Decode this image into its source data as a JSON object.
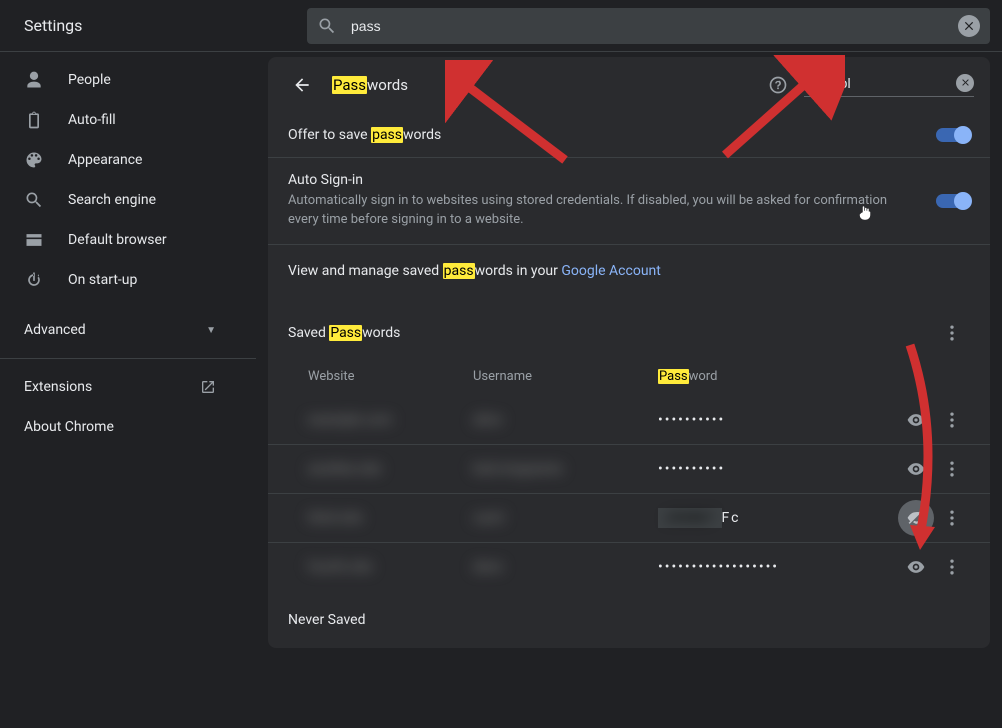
{
  "header": {
    "title": "Settings",
    "search_value": "pass"
  },
  "sidebar": {
    "items": [
      {
        "label": "People"
      },
      {
        "label": "Auto-fill"
      },
      {
        "label": "Appearance"
      },
      {
        "label": "Search engine"
      },
      {
        "label": "Default browser"
      },
      {
        "label": "On start-up"
      }
    ],
    "advanced": "Advanced",
    "extensions": "Extensions",
    "about": "About Chrome"
  },
  "page": {
    "title": {
      "hl": "Pass",
      "rest": "words"
    },
    "filter_value": "tool",
    "offer_to_save": {
      "pre": "Offer to save ",
      "hl": "pass",
      "post": "words"
    },
    "auto_signin": {
      "title": "Auto Sign-in",
      "sub": "Automatically sign in to websites using stored credentials. If disabled, you will be asked for confirmation every time before signing in to a website."
    },
    "view_manage": {
      "pre": "View and manage saved ",
      "hl": "pass",
      "post": "words in your ",
      "link": "Google Account"
    },
    "saved": {
      "title": {
        "pre": "Saved ",
        "hl": "Pass",
        "post": "words"
      },
      "cols": {
        "website": "Website",
        "username": "Username",
        "password": {
          "hl": "Pass",
          "post": "word"
        }
      },
      "rows": [
        {
          "site": "example.com",
          "user": "alice",
          "mask": "••••••••••",
          "revealed": false
        },
        {
          "site": "another.site",
          "user": "bob.longname",
          "mask": "••••••••••",
          "revealed": false
        },
        {
          "site": "third.site",
          "user": "carol",
          "mask": "",
          "revealed": true,
          "reveal_text": "x9A8b7Fc"
        },
        {
          "site": "fourth.site",
          "user": "dave",
          "mask": "••••••••••••••••••",
          "revealed": false
        }
      ]
    },
    "never_saved": "Never Saved"
  },
  "colors": {
    "accent": "#8ab4f8",
    "highlight": "#ffeb3b"
  }
}
